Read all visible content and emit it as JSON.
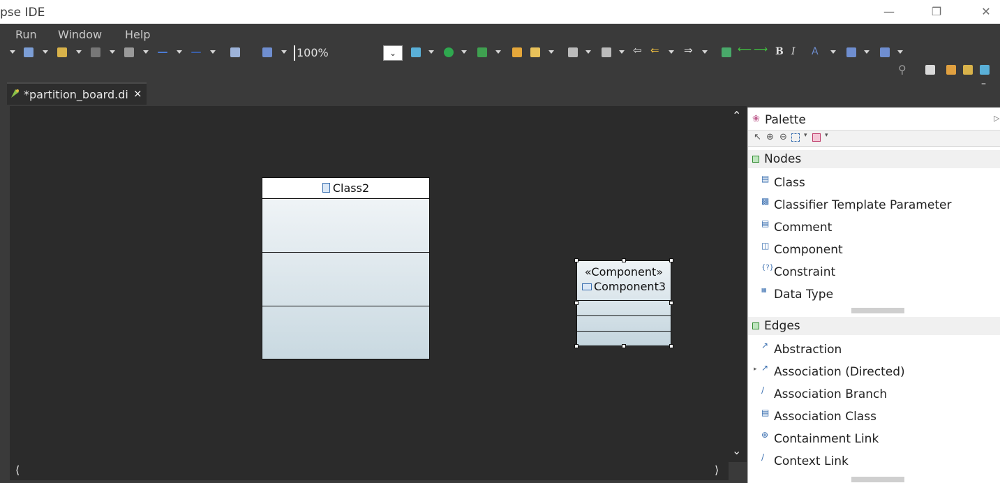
{
  "window": {
    "title": "pse IDE"
  },
  "menu": [
    "Run",
    "Window",
    "Help"
  ],
  "toolbar": {
    "zoom_value": "100%"
  },
  "editor": {
    "tab_label": "*partition_board.di",
    "tab_close": "×"
  },
  "diagram": {
    "class2": {
      "name": "Class2"
    },
    "component3": {
      "stereotype": "«Component»",
      "name": "Component3"
    }
  },
  "palette": {
    "title": "Palette",
    "nodes": {
      "header": "Nodes",
      "items": [
        "Class",
        "Classifier Template Parameter",
        "Comment",
        "Component",
        "Constraint",
        "Data Type"
      ]
    },
    "edges": {
      "header": "Edges",
      "items": [
        "Abstraction",
        "Association (Directed)",
        "Association Branch",
        "Association Class",
        "Containment Link",
        "Context Link"
      ]
    }
  }
}
